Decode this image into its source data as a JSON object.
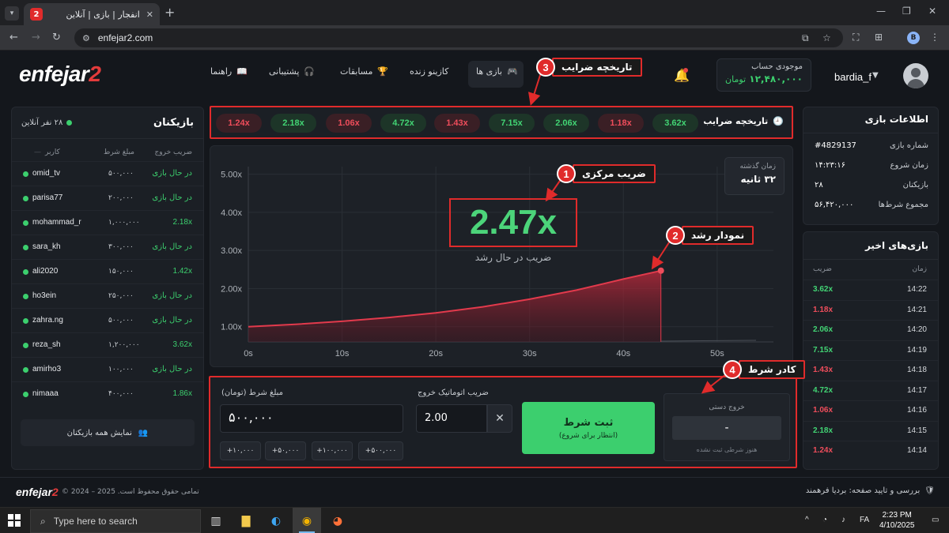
{
  "browser": {
    "tab_title": "انفجار | بازی | آنلاین",
    "tab_favicon": "2",
    "url": "enfejar2.com",
    "profile_initial": "B"
  },
  "header": {
    "logo_main": "enfejar",
    "logo_num": "2",
    "menu": [
      {
        "label": "بازی ها",
        "icon": "gamepad-icon"
      },
      {
        "label": "کازینو زنده",
        "icon": ""
      },
      {
        "label": "مسابقات",
        "icon": "trophy-icon"
      },
      {
        "label": "پشتیبانی",
        "icon": "headset-icon"
      },
      {
        "label": "راهنما",
        "icon": "book-icon"
      }
    ],
    "wallet_label": "موجودی حساب",
    "wallet_value": "۱۲,۴۸۰,۰۰۰",
    "wallet_unit": "تومان",
    "username": "bardia_f"
  },
  "players": {
    "title": "بازیکنان",
    "online": "۲۸ نفر آنلاین",
    "col_user": "کاربر",
    "col_bet": "مبلغ شرط",
    "col_cashout": "ضریب خروج",
    "rows": [
      {
        "name": "omid_tv",
        "bet": "۵۰۰,۰۰۰",
        "status": "در حال بازی",
        "won": false
      },
      {
        "name": "parisa77",
        "bet": "۲۰۰,۰۰۰",
        "status": "در حال بازی",
        "won": false
      },
      {
        "name": "mohammad_r",
        "bet": "۱,۰۰۰,۰۰۰",
        "status": "2.18x",
        "won": true
      },
      {
        "name": "sara_kh",
        "bet": "۳۰۰,۰۰۰",
        "status": "در حال بازی",
        "won": false
      },
      {
        "name": "ali2020",
        "bet": "۱۵۰,۰۰۰",
        "status": "1.42x",
        "won": true
      },
      {
        "name": "ho3ein",
        "bet": "۲۵۰,۰۰۰",
        "status": "در حال بازی",
        "won": false
      },
      {
        "name": "zahra.ng",
        "bet": "۵۰۰,۰۰۰",
        "status": "در حال بازی",
        "won": false
      },
      {
        "name": "reza_sh",
        "bet": "۱,۲۰۰,۰۰۰",
        "status": "3.62x",
        "won": true
      },
      {
        "name": "amirho3",
        "bet": "۱۰۰,۰۰۰",
        "status": "در حال بازی",
        "won": false
      },
      {
        "name": "nimaaa",
        "bet": "۴۰۰,۰۰۰",
        "status": "1.86x",
        "won": true
      }
    ],
    "show_all": "نمایش همه بازیکنان"
  },
  "history": {
    "label": "تاریخچه ضرایب",
    "chips": [
      {
        "value": "1.24x",
        "color": "r"
      },
      {
        "value": "2.18x",
        "color": "g"
      },
      {
        "value": "1.06x",
        "color": "r"
      },
      {
        "value": "4.72x",
        "color": "g"
      },
      {
        "value": "1.43x",
        "color": "r"
      },
      {
        "value": "7.15x",
        "color": "g"
      },
      {
        "value": "2.06x",
        "color": "g"
      },
      {
        "value": "1.18x",
        "color": "r"
      },
      {
        "value": "3.62x",
        "color": "g"
      }
    ]
  },
  "game": {
    "multiplier": "2.47x",
    "status": "ضریب در حال رشد",
    "elapsed_label": "زمان گذشته",
    "elapsed_value": "۳۲ ثانیه",
    "y_ticks": [
      "1.00x",
      "2.00x",
      "3.00x",
      "4.00x",
      "5.00x"
    ],
    "x_ticks": [
      "0s",
      "10s",
      "20s",
      "30s",
      "40s",
      "50s"
    ]
  },
  "chart_data": {
    "type": "area",
    "x": [
      0,
      5,
      10,
      15,
      20,
      25,
      30,
      35,
      40,
      44
    ],
    "y": [
      1.0,
      1.06,
      1.14,
      1.24,
      1.36,
      1.52,
      1.72,
      1.96,
      2.25,
      2.47
    ],
    "xlim": [
      0,
      56
    ],
    "ylim": [
      0.6,
      5.2
    ],
    "grid": true,
    "line_color": "#e23a4c"
  },
  "callouts": [
    {
      "num": "1",
      "label": "ضریب مرکزی"
    },
    {
      "num": "2",
      "label": "نمودار رشد"
    },
    {
      "num": "3",
      "label": "تاریخچه ضرایب"
    },
    {
      "num": "4",
      "label": "کادر شرط"
    }
  ],
  "bet": {
    "amount_label": "مبلغ شرط (تومان)",
    "amount_value": "۵۰۰,۰۰۰",
    "quick": [
      "+۱۰,۰۰۰",
      "+۵۰,۰۰۰",
      "+۱۰۰,۰۰۰",
      "+۵۰۰,۰۰۰"
    ],
    "auto_label": "ضریب اتوماتیک خروج",
    "auto_value": "2.00",
    "place_title": "ثبت شرط",
    "place_sub": "(انتظار برای شروع)",
    "cashout_label": "خروج دستی",
    "cashout_value": "-",
    "cashout_note": "هنوز شرطی ثبت نشده"
  },
  "info": {
    "title": "اطلاعات بازی",
    "rows": [
      {
        "k": "شماره بازی",
        "v": "#4829137"
      },
      {
        "k": "زمان شروع",
        "v": "۱۴:۲۳:۱۶"
      },
      {
        "k": "بازیکنان",
        "v": "۲۸"
      },
      {
        "k": "مجموع شرط‌ها",
        "v": "۵۶,۴۲۰,۰۰۰"
      }
    ]
  },
  "recent": {
    "title": "بازی‌های اخیر",
    "col_time": "زمان",
    "col_mult": "ضریب",
    "rows": [
      {
        "time": "14:22",
        "mult": "3.62x",
        "win": true
      },
      {
        "time": "14:21",
        "mult": "1.18x",
        "win": false
      },
      {
        "time": "14:20",
        "mult": "2.06x",
        "win": true
      },
      {
        "time": "14:19",
        "mult": "7.15x",
        "win": true
      },
      {
        "time": "14:18",
        "mult": "1.43x",
        "win": false
      },
      {
        "time": "14:17",
        "mult": "4.72x",
        "win": true
      },
      {
        "time": "14:16",
        "mult": "1.06x",
        "win": false
      },
      {
        "time": "14:15",
        "mult": "2.18x",
        "win": true
      },
      {
        "time": "14:14",
        "mult": "1.24x",
        "win": false
      }
    ]
  },
  "footer": {
    "logo_main": "enfejar",
    "logo_num": "2",
    "copyright": "تمامی حقوق محفوظ است. 2025 – 2024 ©",
    "review": "بررسی و تایید صفحه: بردیا فرهمند"
  },
  "taskbar": {
    "search_placeholder": "Type here to search",
    "lang": "FA",
    "time": "2:23 PM",
    "date": "4/10/2025"
  },
  "colors": {
    "accent_red": "#e02b2b",
    "green": "#3ccf6e",
    "bg": "#14171c"
  }
}
